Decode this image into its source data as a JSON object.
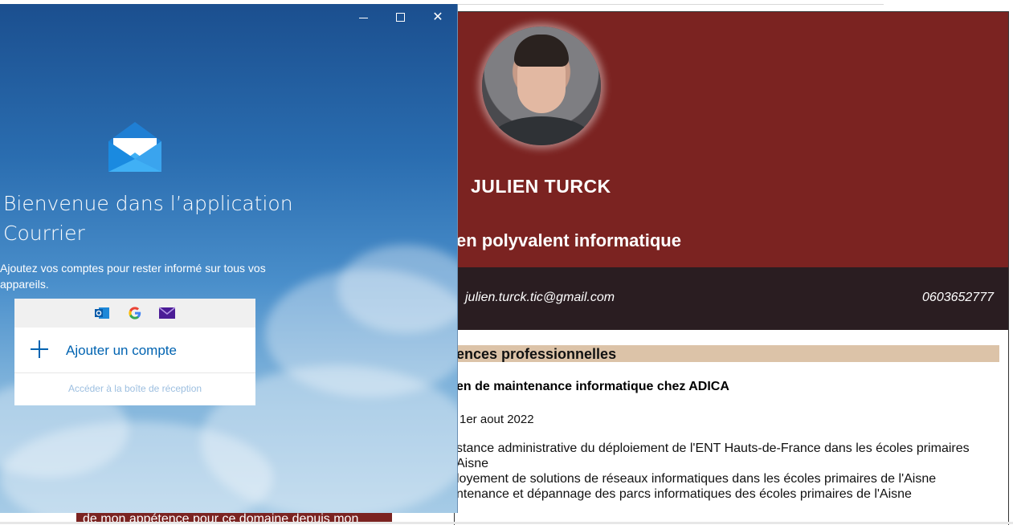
{
  "mail_window": {
    "welcome_line1": "Bienvenue dans l’application",
    "welcome_line2": "Courrier",
    "subtitle_line1": "Ajoutez vos comptes pour rester informé sur tous vos",
    "subtitle_line2": "appareils.",
    "add_account_label": "Ajouter un compte",
    "inbox_link_label": "Accéder à la boîte de réception",
    "titlebar": {
      "minimize_icon": "minimize-icon",
      "maximize_icon": "maximize-icon",
      "close_glyph": "✕"
    },
    "providers": [
      "outlook-icon",
      "google-icon",
      "mail-icon"
    ]
  },
  "cv": {
    "name": "JULIEN TURCK",
    "job_title": "en polyvalent informatique",
    "email": "julien.turck.tic@gmail.com",
    "phone": "0603652777",
    "section_title": "ences professionnelles",
    "experience": {
      "title": "en de maintenance informatique chez ADICA",
      "date": "1er aout 2022",
      "items": [
        "stance administrative du déploiement de l'ENT Hauts-de-France dans les écoles primaires",
        "Aisne",
        "loyement de solutions de réseaux informatiques dans les écoles primaires de l'Aisne",
        "ntenance et dépannage des parcs informatiques des écoles primaires de l'Aisne"
      ]
    },
    "left_footer_text": "de mon appétence pour ce domaine depuis mon"
  },
  "colors": {
    "header_red": "#7b2321",
    "contact_dark": "#2a1d21",
    "section_beige": "#dcc3a8",
    "mail_blue": "#0063b1"
  }
}
